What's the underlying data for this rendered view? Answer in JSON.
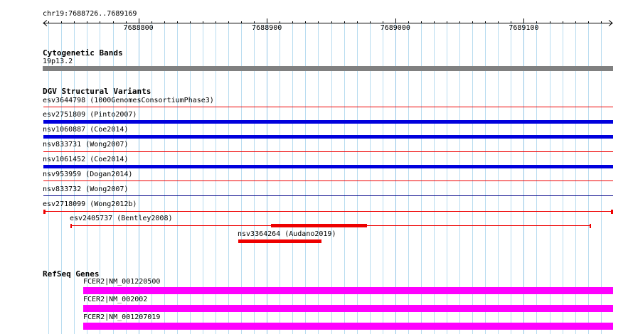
{
  "ruler": {
    "label": "chr19:7688726..7689169",
    "start": 7688726,
    "end": 7689169,
    "major_ticks": [
      {
        "pos": 7688800,
        "label": "7688800"
      },
      {
        "pos": 7688900,
        "label": "7688900"
      },
      {
        "pos": 7689000,
        "label": "7689000"
      },
      {
        "pos": 7689100,
        "label": "7689100"
      }
    ]
  },
  "colors": {
    "grid": "#b8dcf0",
    "band": "#808080",
    "dgv_blue": "#0000dd",
    "dgv_red": "#ee0000",
    "dgv_darkblue": "#000088",
    "refseq": "#ff00ff"
  },
  "cytoband": {
    "title": "Cytogenetic Bands",
    "band_label": "19p13.2"
  },
  "dgv": {
    "title": "DGV Structural Variants",
    "items": [
      {
        "label": "esv3644798 (1000GenomesConsortiumPhase3)",
        "start": 7688726,
        "end": 7689169,
        "kind": "thin",
        "color": "#ee0000"
      },
      {
        "label": "esv2751809 (Pinto2007)",
        "start": 7688726,
        "end": 7689169,
        "kind": "thick",
        "color": "#0000dd"
      },
      {
        "label": "nsv1060887 (Coe2014)",
        "start": 7688726,
        "end": 7689169,
        "kind": "thick",
        "color": "#0000dd"
      },
      {
        "label": "nsv833731 (Wong2007)",
        "start": 7688726,
        "end": 7689169,
        "kind": "thin",
        "color": "#ee0000"
      },
      {
        "label": "nsv1061452 (Coe2014)",
        "start": 7688726,
        "end": 7689169,
        "kind": "thick",
        "color": "#0000dd"
      },
      {
        "label": "nsv953959 (Dogan2014)",
        "start": 7688726,
        "end": 7689169,
        "kind": "thin",
        "color": "#ee0000"
      },
      {
        "label": "nsv833732 (Wong2007)",
        "start": 7688726,
        "end": 7689169,
        "kind": "thin",
        "color": "#000088"
      },
      {
        "label": "esv2718099 (Wong2012b)",
        "start": 7688726,
        "end": 7689169,
        "kind": "capped",
        "color": "#ee0000"
      },
      {
        "label": "esv2405737 (Bentley2008)",
        "start": 7688747,
        "end": 7689152,
        "kind": "capped-thick",
        "color": "#ee0000",
        "thick_start": 7688903,
        "thick_end": 7688978
      },
      {
        "label": "nsv3364264 (Audano2019)",
        "start": 7688878,
        "end": 7688942,
        "kind": "thick-only",
        "color": "#ee0000"
      }
    ]
  },
  "refseq": {
    "title": "RefSeq Genes",
    "items": [
      {
        "label": "FCER2|NM_001220500",
        "start": 7688757,
        "end": 7689169
      },
      {
        "label": "FCER2|NM_002002",
        "start": 7688757,
        "end": 7689169
      },
      {
        "label": "FCER2|NM_001207019",
        "start": 7688757,
        "end": 7689169
      }
    ]
  }
}
